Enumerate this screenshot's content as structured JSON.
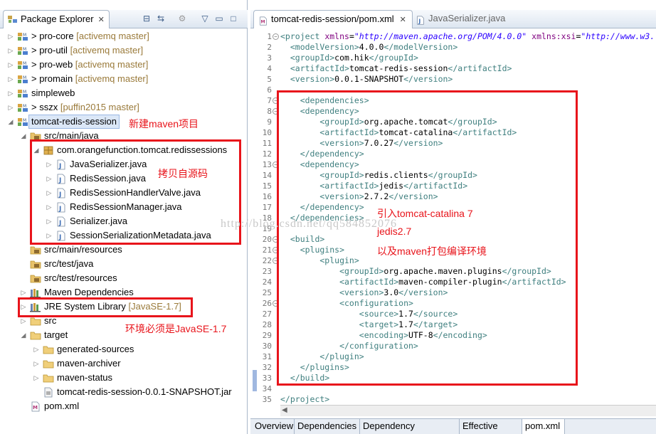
{
  "explorer": {
    "title": "Package Explorer",
    "close": "✕",
    "tree": [
      {
        "label": "pro-core",
        "prefix": "> ",
        "decor": "[activemq master]",
        "indent": 0,
        "icon": "project-icon",
        "twisty": "▷"
      },
      {
        "label": "pro-util",
        "prefix": "> ",
        "decor": "[activemq master]",
        "indent": 0,
        "icon": "project-icon",
        "twisty": "▷"
      },
      {
        "label": "pro-web",
        "prefix": "> ",
        "decor": "[activemq master]",
        "indent": 0,
        "icon": "project-icon",
        "twisty": "▷"
      },
      {
        "label": "promain",
        "prefix": "> ",
        "decor": "[activemq master]",
        "indent": 0,
        "icon": "project-icon",
        "twisty": "▷"
      },
      {
        "label": "simpleweb",
        "prefix": "",
        "decor": "",
        "indent": 0,
        "icon": "project-icon",
        "twisty": "▷"
      },
      {
        "label": "sszx",
        "prefix": "> ",
        "decor": "[puffin2015 master]",
        "indent": 0,
        "icon": "project-icon",
        "twisty": "▷"
      },
      {
        "label": "tomcat-redis-session",
        "prefix": "",
        "decor": "",
        "indent": 0,
        "icon": "project-icon",
        "twisty": "◢",
        "selected": true
      },
      {
        "label": "src/main/java",
        "prefix": "",
        "decor": "",
        "indent": 1,
        "icon": "source-folder-icon",
        "twisty": "◢"
      },
      {
        "label": "com.orangefunction.tomcat.redissessions",
        "prefix": "",
        "decor": "",
        "indent": 2,
        "icon": "package-icon",
        "twisty": "◢"
      },
      {
        "label": "JavaSerializer.java",
        "prefix": "",
        "decor": "",
        "indent": 3,
        "icon": "java-file-icon",
        "twisty": "▷"
      },
      {
        "label": "RedisSession.java",
        "prefix": "",
        "decor": "",
        "indent": 3,
        "icon": "java-file-icon",
        "twisty": "▷"
      },
      {
        "label": "RedisSessionHandlerValve.java",
        "prefix": "",
        "decor": "",
        "indent": 3,
        "icon": "java-file-icon",
        "twisty": "▷"
      },
      {
        "label": "RedisSessionManager.java",
        "prefix": "",
        "decor": "",
        "indent": 3,
        "icon": "java-file-icon",
        "twisty": "▷"
      },
      {
        "label": "Serializer.java",
        "prefix": "",
        "decor": "",
        "indent": 3,
        "icon": "java-file-icon",
        "twisty": "▷"
      },
      {
        "label": "SessionSerializationMetadata.java",
        "prefix": "",
        "decor": "",
        "indent": 3,
        "icon": "java-file-icon",
        "twisty": "▷"
      },
      {
        "label": "src/main/resources",
        "prefix": "",
        "decor": "",
        "indent": 1,
        "icon": "source-folder-icon",
        "twisty": ""
      },
      {
        "label": "src/test/java",
        "prefix": "",
        "decor": "",
        "indent": 1,
        "icon": "source-folder-icon",
        "twisty": ""
      },
      {
        "label": "src/test/resources",
        "prefix": "",
        "decor": "",
        "indent": 1,
        "icon": "source-folder-icon",
        "twisty": ""
      },
      {
        "label": "Maven Dependencies",
        "prefix": "",
        "decor": "",
        "indent": 1,
        "icon": "library-icon",
        "twisty": "▷"
      },
      {
        "label": "JRE System Library",
        "prefix": "",
        "decor": "[JavaSE-1.7]",
        "indent": 1,
        "icon": "library-icon",
        "twisty": "▷"
      },
      {
        "label": "src",
        "prefix": "",
        "decor": "",
        "indent": 1,
        "icon": "folder-icon",
        "twisty": "▷"
      },
      {
        "label": "target",
        "prefix": "",
        "decor": "",
        "indent": 1,
        "icon": "folder-icon",
        "twisty": "◢"
      },
      {
        "label": "generated-sources",
        "prefix": "",
        "decor": "",
        "indent": 2,
        "icon": "folder-icon",
        "twisty": "▷"
      },
      {
        "label": "maven-archiver",
        "prefix": "",
        "decor": "",
        "indent": 2,
        "icon": "folder-icon",
        "twisty": "▷"
      },
      {
        "label": "maven-status",
        "prefix": "",
        "decor": "",
        "indent": 2,
        "icon": "folder-icon",
        "twisty": "▷"
      },
      {
        "label": "tomcat-redis-session-0.0.1-SNAPSHOT.jar",
        "prefix": "",
        "decor": "",
        "indent": 2,
        "icon": "jar-file-icon",
        "twisty": ""
      },
      {
        "label": "pom.xml",
        "prefix": "",
        "decor": "",
        "indent": 1,
        "icon": "xml-file-icon",
        "twisty": ""
      }
    ]
  },
  "editor": {
    "tabs": [
      {
        "label": "tomcat-redis-session/pom.xml",
        "active": true,
        "close": "✕",
        "icon": "xml-file-icon"
      },
      {
        "label": "JavaSerializer.java",
        "active": false,
        "close": "",
        "icon": "java-file-icon"
      }
    ],
    "lines": [
      [
        [
          "t",
          "<project "
        ],
        [
          "a",
          "xmlns"
        ],
        [
          "tx",
          "="
        ],
        [
          "v",
          "\"http://maven.apache.org/POM/4.0.0\""
        ],
        [
          "tx",
          " "
        ],
        [
          "a",
          "xmlns:xsi"
        ],
        [
          "tx",
          "="
        ],
        [
          "v",
          "\"http://www.w3."
        ]
      ],
      [
        [
          "t",
          "  <modelVersion>"
        ],
        [
          "tx",
          "4.0.0"
        ],
        [
          "t",
          "</modelVersion>"
        ]
      ],
      [
        [
          "t",
          "  <groupId>"
        ],
        [
          "tx",
          "com.hik"
        ],
        [
          "t",
          "</groupId>"
        ]
      ],
      [
        [
          "t",
          "  <artifactId>"
        ],
        [
          "tx",
          "tomcat-redis-session"
        ],
        [
          "t",
          "</artifactId>"
        ]
      ],
      [
        [
          "t",
          "  <version>"
        ],
        [
          "tx",
          "0.0.1-SNAPSHOT"
        ],
        [
          "t",
          "</version>"
        ]
      ],
      [
        [
          "tx",
          ""
        ]
      ],
      [
        [
          "t",
          "    <dependencies>"
        ]
      ],
      [
        [
          "t",
          "    <dependency>"
        ]
      ],
      [
        [
          "t",
          "        <groupId>"
        ],
        [
          "tx",
          "org.apache.tomcat"
        ],
        [
          "t",
          "</groupId>"
        ]
      ],
      [
        [
          "t",
          "        <artifactId>"
        ],
        [
          "tx",
          "tomcat-catalina"
        ],
        [
          "t",
          "</artifactId>"
        ]
      ],
      [
        [
          "t",
          "        <version>"
        ],
        [
          "tx",
          "7.0.27"
        ],
        [
          "t",
          "</version>"
        ]
      ],
      [
        [
          "t",
          "    </dependency>"
        ]
      ],
      [
        [
          "t",
          "    <dependency>"
        ]
      ],
      [
        [
          "t",
          "        <groupId>"
        ],
        [
          "tx",
          "redis.clients"
        ],
        [
          "t",
          "</groupId>"
        ]
      ],
      [
        [
          "t",
          "        <artifactId>"
        ],
        [
          "tx",
          "jedis"
        ],
        [
          "t",
          "</artifactId>"
        ]
      ],
      [
        [
          "t",
          "        <version>"
        ],
        [
          "tx",
          "2.7.2"
        ],
        [
          "t",
          "</version>"
        ]
      ],
      [
        [
          "t",
          "    </dependency>"
        ]
      ],
      [
        [
          "t",
          "  </dependencies>"
        ]
      ],
      [
        [
          "tx",
          ""
        ]
      ],
      [
        [
          "t",
          "  <build>"
        ]
      ],
      [
        [
          "t",
          "    <plugins>"
        ]
      ],
      [
        [
          "t",
          "        <plugin>"
        ]
      ],
      [
        [
          "t",
          "            <groupId>"
        ],
        [
          "tx",
          "org.apache.maven.plugins"
        ],
        [
          "t",
          "</groupId>"
        ]
      ],
      [
        [
          "t",
          "            <artifactId>"
        ],
        [
          "tx",
          "maven-compiler-plugin"
        ],
        [
          "t",
          "</artifactId>"
        ]
      ],
      [
        [
          "t",
          "            <version>"
        ],
        [
          "tx",
          "3.0"
        ],
        [
          "t",
          "</version>"
        ]
      ],
      [
        [
          "t",
          "            <configuration>"
        ]
      ],
      [
        [
          "t",
          "                <source>"
        ],
        [
          "tx",
          "1.7"
        ],
        [
          "t",
          "</source>"
        ]
      ],
      [
        [
          "t",
          "                <target>"
        ],
        [
          "tx",
          "1.7"
        ],
        [
          "t",
          "</target>"
        ]
      ],
      [
        [
          "t",
          "                <encoding>"
        ],
        [
          "tx",
          "UTF-8"
        ],
        [
          "t",
          "</encoding>"
        ]
      ],
      [
        [
          "t",
          "            </configuration>"
        ]
      ],
      [
        [
          "t",
          "        </plugin>"
        ]
      ],
      [
        [
          "t",
          "    </plugins>"
        ]
      ],
      [
        [
          "t",
          "  </build>"
        ]
      ],
      [
        [
          "tx",
          ""
        ]
      ],
      [
        [
          "t",
          "</project>"
        ]
      ]
    ],
    "bottom_tabs": [
      {
        "label": "Overview",
        "active": false
      },
      {
        "label": "Dependencies",
        "active": false
      },
      {
        "label": "Dependency Hierarchy",
        "active": false
      },
      {
        "label": "Effective POM",
        "active": false
      },
      {
        "label": "pom.xml",
        "active": true
      }
    ]
  },
  "annotations": {
    "new_project": "新建maven项目",
    "copied_source": "拷贝自源码",
    "jre_note": "环境必须是JavaSE-1.7",
    "deps_note_1": "引入tomcat-catalina 7",
    "deps_note_2": "jedis2.7",
    "deps_note_3": "以及maven打包编译环境"
  },
  "watermark": "http://blog.csdn.net/qq584852076",
  "colors": {
    "annotation": "#e8141b",
    "tag": "#3f7f7f",
    "attr": "#7f007f",
    "string": "#2a00ff"
  }
}
